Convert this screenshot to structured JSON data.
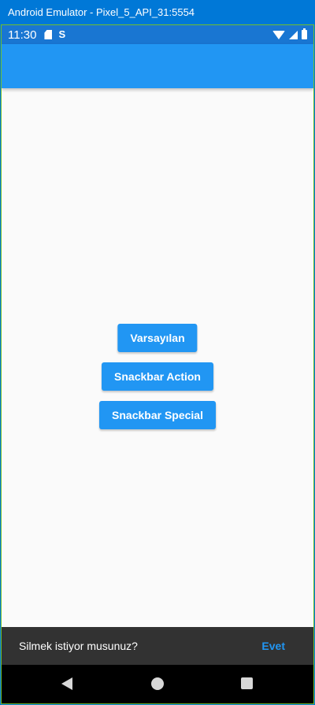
{
  "window": {
    "title": "Android Emulator - Pixel_5_API_31:5554"
  },
  "status_bar": {
    "time": "11:30",
    "sync_glyph": "S",
    "icons": [
      "sd-card-icon",
      "sync-icon",
      "wifi-icon",
      "signal-icon",
      "battery-icon"
    ]
  },
  "app_bar": {
    "color": "#2196f3"
  },
  "buttons": {
    "default_label": "Varsayılan",
    "action_label": "Snackbar Action",
    "special_label": "Snackbar Special"
  },
  "snackbar": {
    "message": "Silmek istiyor musunuz?",
    "action_label": "Evet"
  },
  "nav_bar": {
    "icons": [
      "back-icon",
      "home-icon",
      "recents-icon"
    ]
  },
  "colors": {
    "accent": "#2196f3",
    "status_bar": "#1976d2",
    "window_chrome": "#0078d7",
    "snackbar_bg": "#323232"
  }
}
